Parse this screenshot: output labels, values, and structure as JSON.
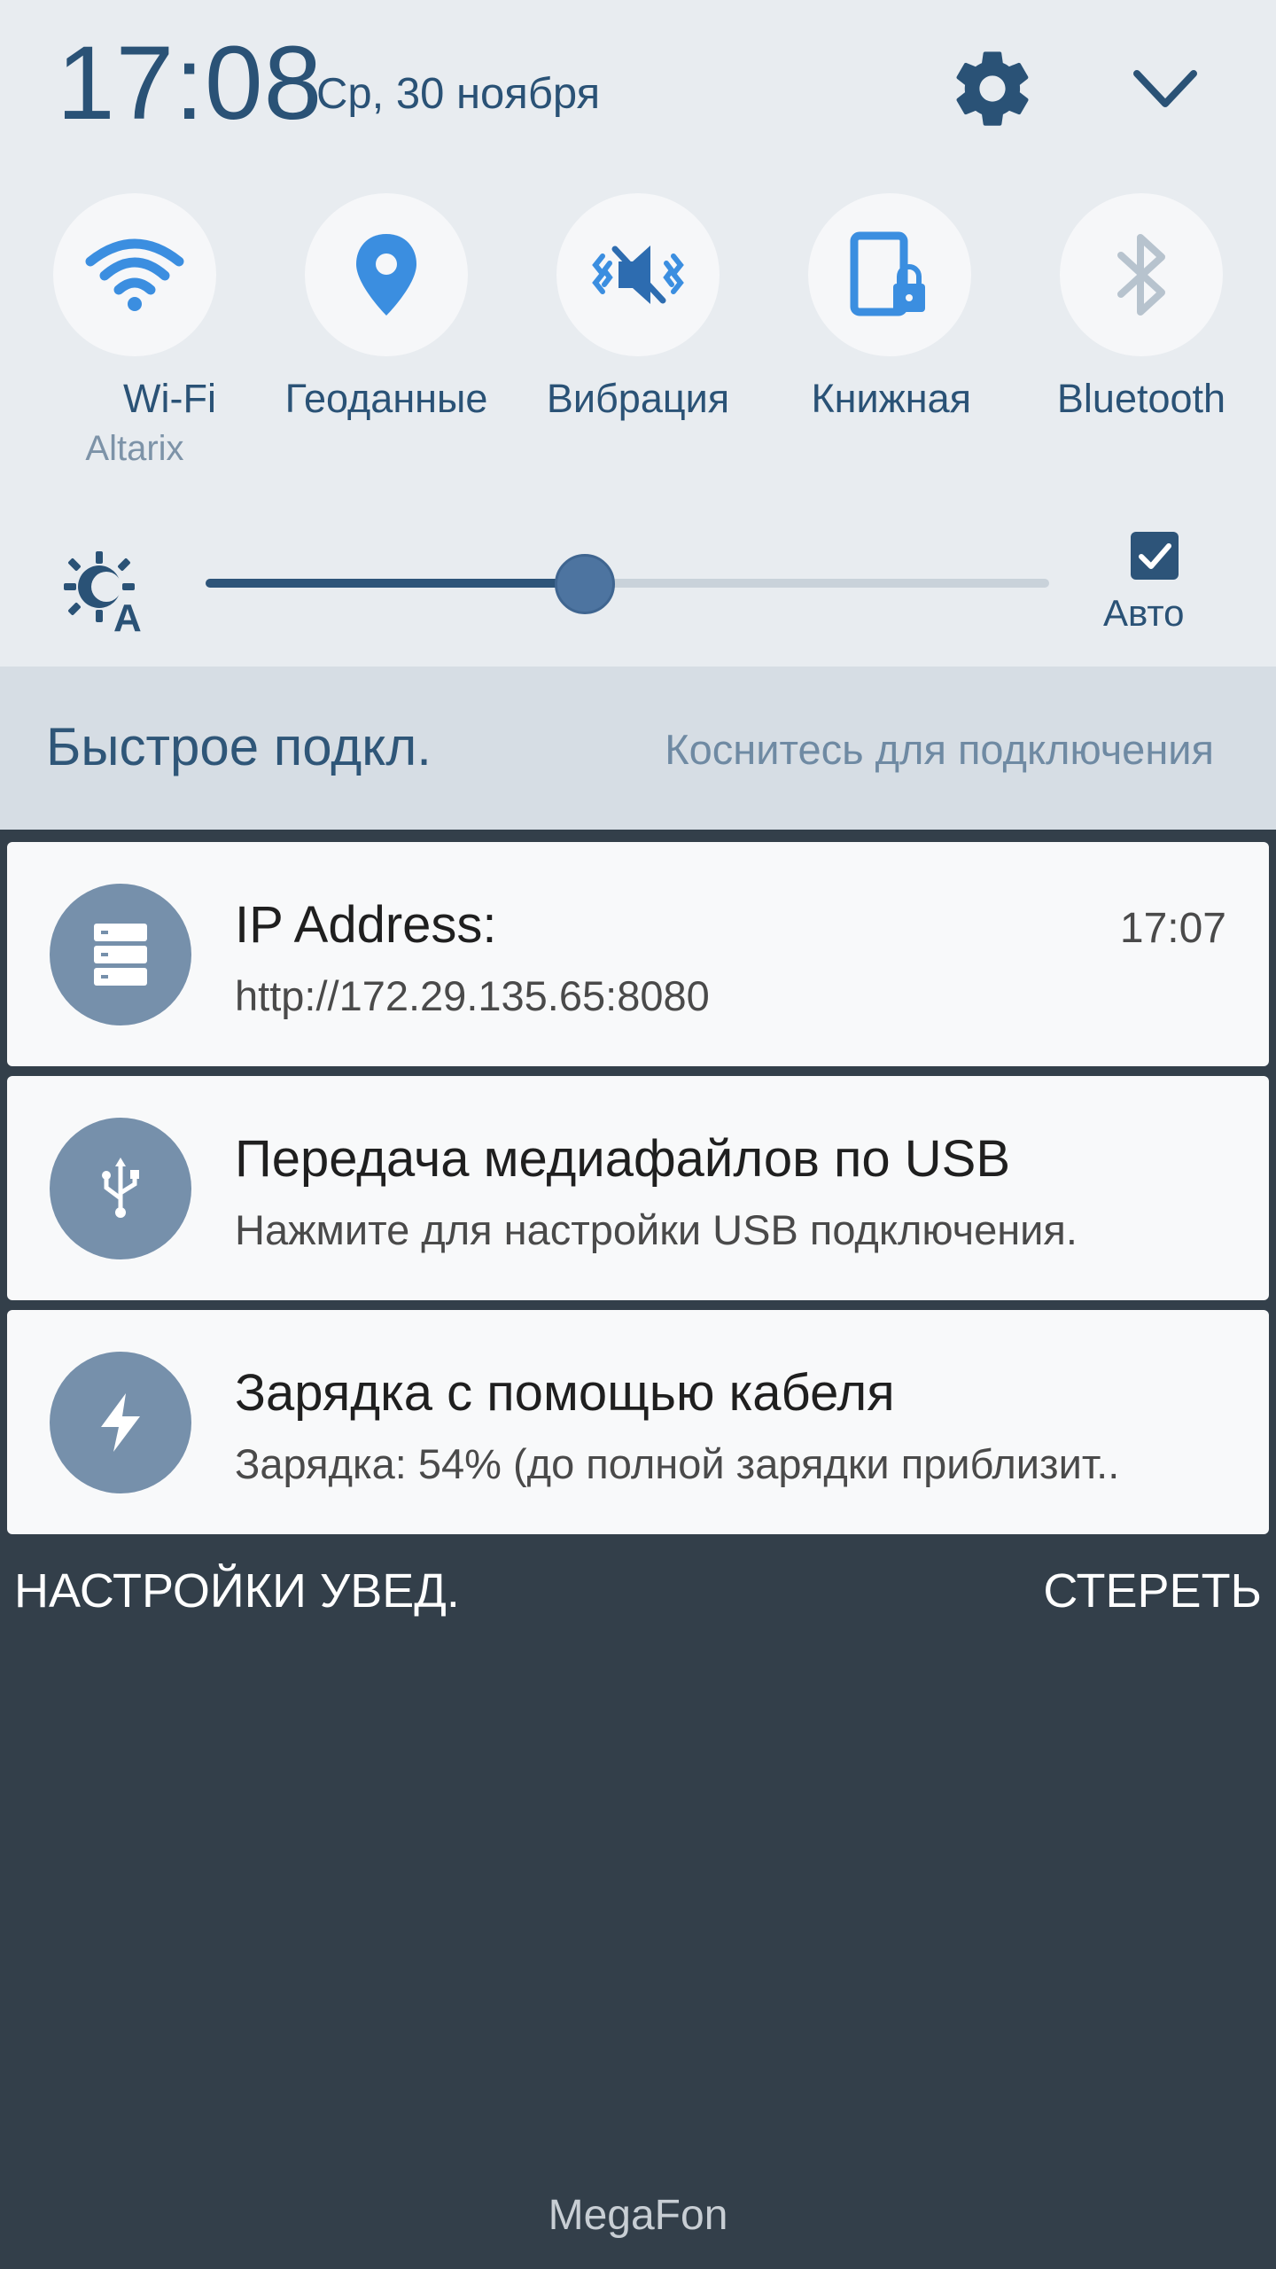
{
  "header": {
    "time": "17:08",
    "date": "Ср, 30 ноября"
  },
  "toggles": [
    {
      "label": "Wi-Fi",
      "sub": "Altarix",
      "icon": "wifi-icon",
      "active": true
    },
    {
      "label": "Геоданные",
      "sub": "",
      "icon": "location-icon",
      "active": true
    },
    {
      "label": "Вибрация",
      "sub": "",
      "icon": "vibrate-icon",
      "active": true
    },
    {
      "label": "Книжная",
      "sub": "",
      "icon": "portrait-lock-icon",
      "active": true
    },
    {
      "label": "Bluetooth",
      "sub": "",
      "icon": "bluetooth-icon",
      "active": false
    }
  ],
  "brightness": {
    "level": 0.45,
    "auto_label": "Авто",
    "auto_checked": true
  },
  "quick_connect": {
    "title": "Быстрое подкл.",
    "hint": "Коснитесь для подключения"
  },
  "notifications": [
    {
      "title": "IP Address:",
      "text": "http://172.29.135.65:8080",
      "time": "17:07",
      "icon": "server-icon"
    },
    {
      "title": "Передача медиафайлов по USB",
      "text": "Нажмите для настройки USB подключения.",
      "time": "",
      "icon": "usb-icon"
    },
    {
      "title": "Зарядка с помощью кабеля",
      "text": "Зарядка: 54% (до полной зарядки приблизит..",
      "time": "",
      "icon": "bolt-icon"
    }
  ],
  "actions": {
    "settings_label": "НАСТРОЙКИ УВЕД.",
    "clear_label": "СТЕРЕТЬ"
  },
  "carrier": "MegaFon",
  "colors": {
    "accent": "#2a5276",
    "icon_active": "#3b8ee0",
    "icon_inactive": "#b7c3ce",
    "notif_avatar": "#7690ab",
    "background_dark": "#333f4a"
  }
}
